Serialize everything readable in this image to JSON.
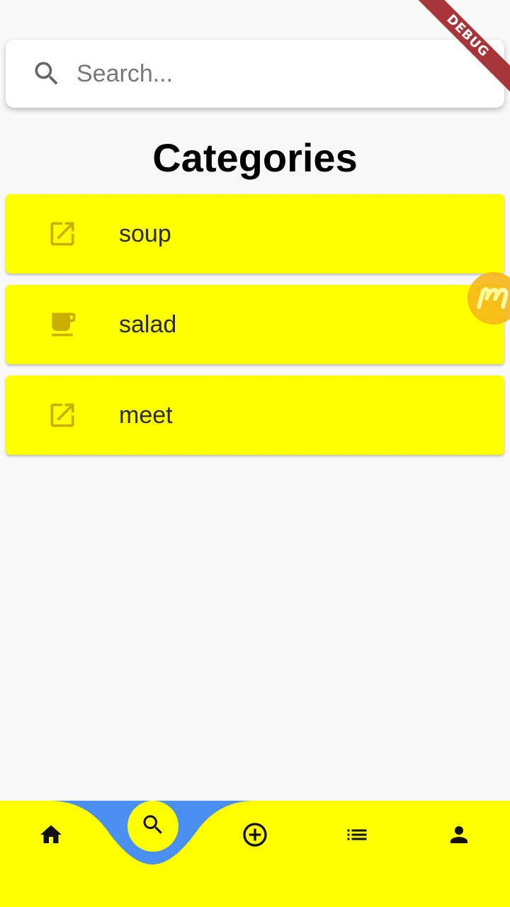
{
  "debug_banner": "DEBUG",
  "search": {
    "placeholder": "Search...",
    "value": ""
  },
  "page_title": "Categories",
  "categories": [
    {
      "label": "soup",
      "icon": "open-in-new-icon"
    },
    {
      "label": "salad",
      "icon": "coffee-cup-icon"
    },
    {
      "label": "meet",
      "icon": "open-in-new-icon"
    }
  ],
  "bottom_nav": {
    "items": [
      {
        "name": "home",
        "icon": "home-icon"
      },
      {
        "name": "search",
        "icon": "search-icon",
        "active": true
      },
      {
        "name": "add",
        "icon": "add-circle-icon"
      },
      {
        "name": "list",
        "icon": "list-icon"
      },
      {
        "name": "profile",
        "icon": "person-icon"
      }
    ]
  },
  "colors": {
    "accent": "#ffff00",
    "nav_curve": "#4a90f0",
    "icon": "#c9b000",
    "debug": "#a8353a",
    "bubble": "#f7b71a"
  }
}
